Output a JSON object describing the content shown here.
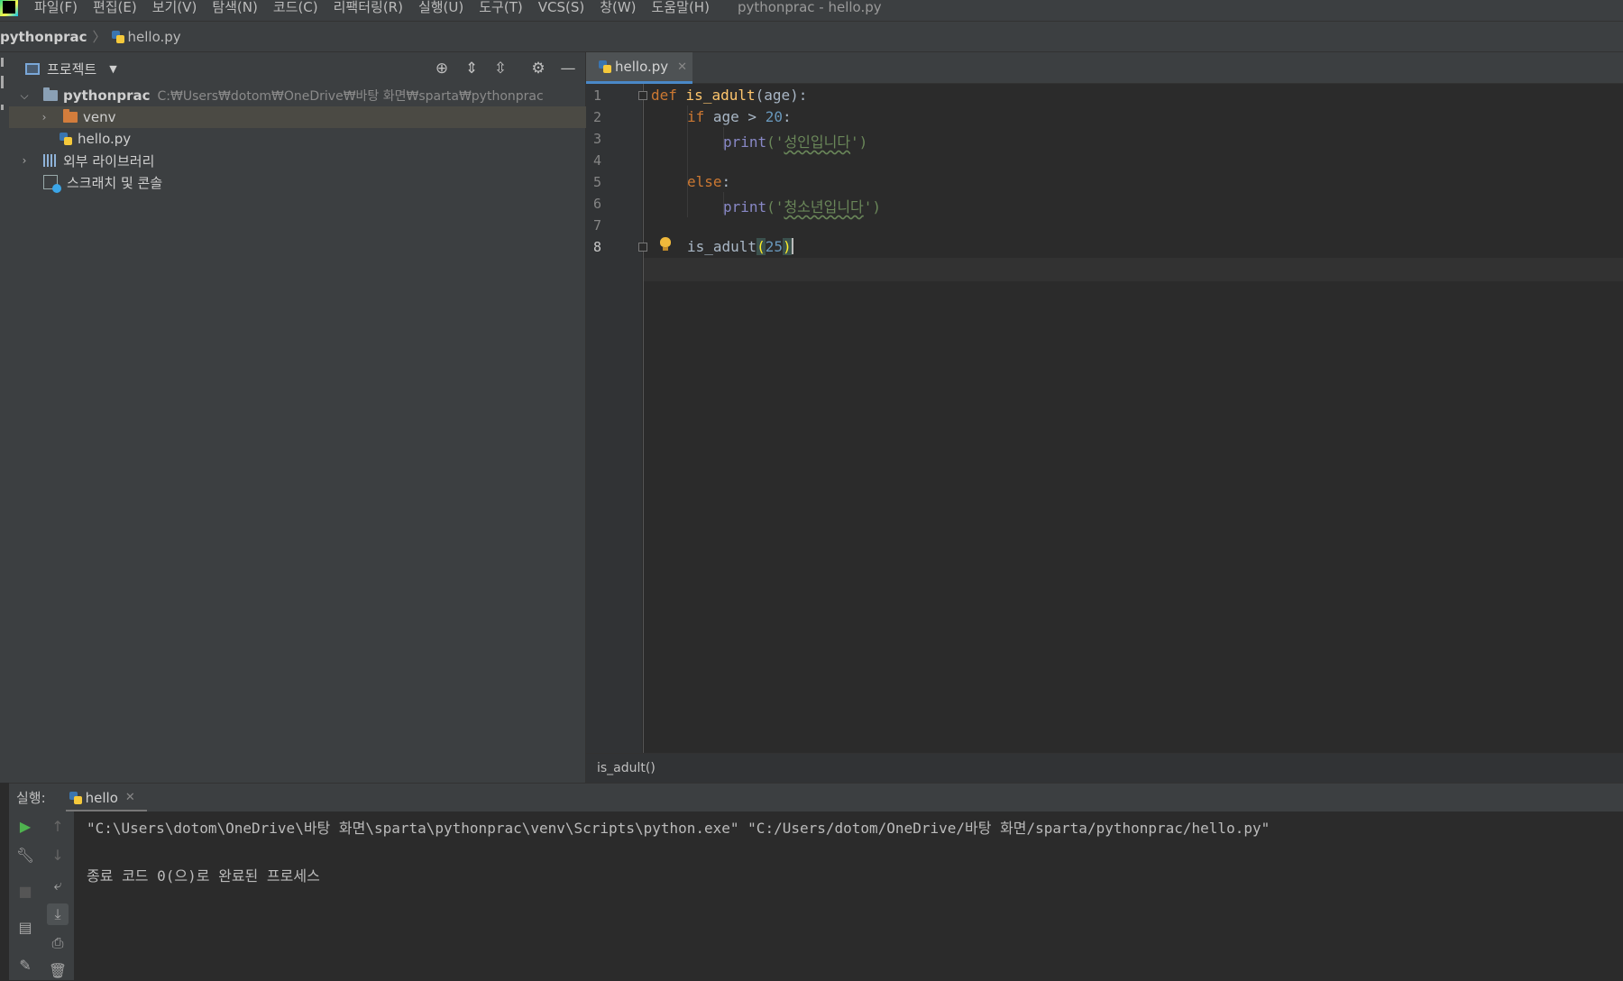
{
  "menubar": {
    "items": [
      "파일(F)",
      "편집(E)",
      "보기(V)",
      "탐색(N)",
      "코드(C)",
      "리팩터링(R)",
      "실행(U)",
      "도구(T)",
      "VCS(S)",
      "창(W)",
      "도움말(H)"
    ],
    "window_title": "pythonprac - hello.py"
  },
  "navbar": {
    "project": "pythonprac",
    "file": "hello.py"
  },
  "project_panel": {
    "title": "프로젝트",
    "root": {
      "name": "pythonprac",
      "path": "C:₩Users₩dotom₩OneDrive₩바탕 화면₩sparta₩pythonprac"
    },
    "items": [
      {
        "label": "venv",
        "type": "folder"
      },
      {
        "label": "hello.py",
        "type": "file"
      },
      {
        "label": "외부 라이브러리",
        "type": "library"
      },
      {
        "label": "스크래치 및 콘솔",
        "type": "scratch"
      }
    ]
  },
  "editor": {
    "tab_label": "hello.py",
    "line_numbers": [
      "1",
      "2",
      "3",
      "4",
      "5",
      "6",
      "7",
      "8"
    ],
    "code": {
      "l1_kw": "def",
      "l1_fn": "is_adult",
      "l1_rest": "(age):",
      "l2_kw": "if",
      "l2_mid": " age > ",
      "l2_num": "20",
      "l2_end": ":",
      "l3_fn": "print",
      "l3_open": "('",
      "l3_str": "성인입니다",
      "l3_close": "')",
      "l5_kw": "else",
      "l5_end": ":",
      "l6_fn": "print",
      "l6_open": "('",
      "l6_str": "청소년입니다",
      "l6_close": "')",
      "l8_call": "is_adult",
      "l8_open": "(",
      "l8_num": "25",
      "l8_close": ")"
    },
    "breadcrumb": "is_adult()"
  },
  "run_panel": {
    "title": "실행:",
    "tab_label": "hello",
    "command": "\"C:\\Users\\dotom\\OneDrive\\바탕 화면\\sparta\\pythonprac\\venv\\Scripts\\python.exe\" \"C:/Users/dotom/OneDrive/바탕 화면/sparta/pythonprac/hello.py\"",
    "result": "종료 코드 0(으)로 완료된 프로세스"
  },
  "colors": {
    "keyword": "#cc7832",
    "function": "#ffc66d",
    "number": "#6897bb",
    "string": "#6a8759",
    "accent": "#4a88c7"
  }
}
